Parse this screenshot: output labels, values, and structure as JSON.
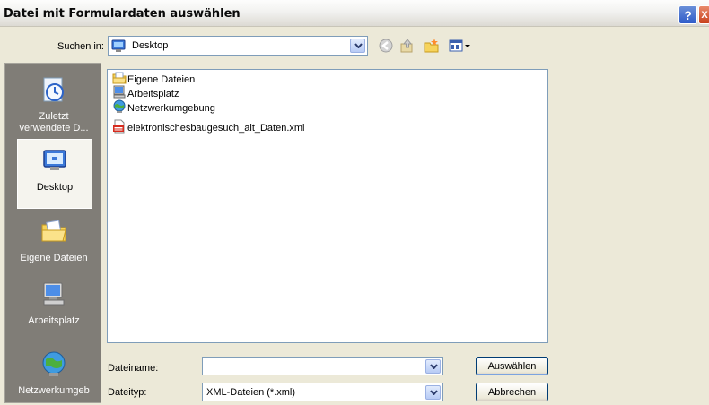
{
  "window": {
    "title": "Datei mit Formulardaten auswählen",
    "help_label": "?",
    "close_label": "X"
  },
  "lookin": {
    "label": "Suchen in:",
    "value": "Desktop",
    "icon": "desktop-icon"
  },
  "toolbar": {
    "icons": [
      "back-arrow-icon",
      "folder-up-icon",
      "new-folder-icon",
      "views-menu-icon"
    ]
  },
  "places": [
    {
      "label": "Zuletzt verwendete D...",
      "icon": "recent-documents-icon",
      "selected": false
    },
    {
      "label": "Desktop",
      "icon": "desktop-icon",
      "selected": true
    },
    {
      "label": "Eigene Dateien",
      "icon": "my-documents-icon",
      "selected": false
    },
    {
      "label": "Arbeitsplatz",
      "icon": "my-computer-icon",
      "selected": false
    },
    {
      "label": "Netzwerkumgeb",
      "icon": "network-places-icon",
      "selected": false
    }
  ],
  "files": [
    {
      "name": "Eigene Dateien",
      "icon": "folder-documents-icon"
    },
    {
      "name": "Arbeitsplatz",
      "icon": "computer-icon"
    },
    {
      "name": "Netzwerkumgebung",
      "icon": "network-icon"
    },
    {
      "name": "elektronischesbaugesuch_alt_Daten.xml",
      "icon": "xml-file-icon"
    }
  ],
  "filename": {
    "label": "Dateiname:",
    "value": ""
  },
  "filetype": {
    "label": "Dateityp:",
    "value": "XML-Dateien (*.xml)"
  },
  "buttons": {
    "open": "Auswählen",
    "cancel": "Abbrechen"
  }
}
